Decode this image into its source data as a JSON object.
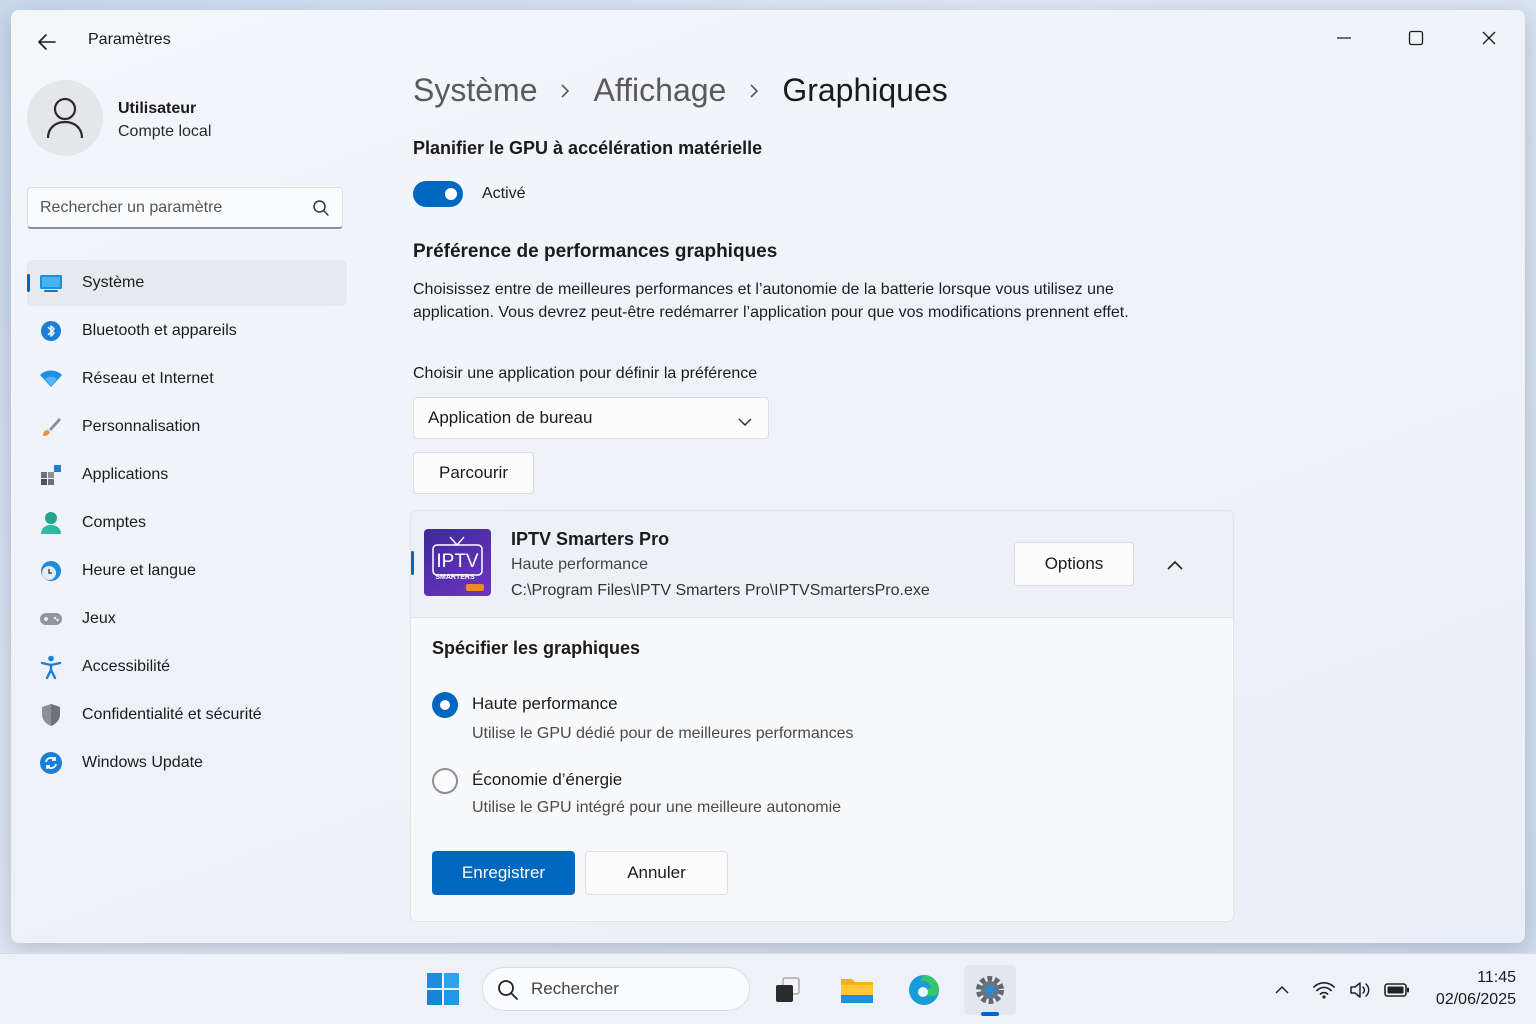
{
  "window": {
    "title": "Paramètres"
  },
  "user": {
    "name": "Utilisateur",
    "account": "Compte local"
  },
  "search": {
    "placeholder": "Rechercher un paramètre"
  },
  "sidebar": {
    "items": [
      {
        "label": "Système",
        "icon": "display-icon",
        "active": true
      },
      {
        "label": "Bluetooth et appareils",
        "icon": "bluetooth-icon"
      },
      {
        "label": "Réseau et Internet",
        "icon": "wifi-icon"
      },
      {
        "label": "Personnalisation",
        "icon": "paintbrush-icon"
      },
      {
        "label": "Applications",
        "icon": "apps-icon"
      },
      {
        "label": "Comptes",
        "icon": "person-icon"
      },
      {
        "label": "Heure et langue",
        "icon": "globe-clock-icon"
      },
      {
        "label": "Jeux",
        "icon": "gamepad-icon"
      },
      {
        "label": "Accessibilité",
        "icon": "accessibility-icon"
      },
      {
        "label": "Confidentialité et sécurité",
        "icon": "shield-icon"
      },
      {
        "label": "Windows Update",
        "icon": "update-icon"
      }
    ]
  },
  "breadcrumb": {
    "items": [
      "Système",
      "Affichage"
    ],
    "current": "Graphiques"
  },
  "gpu_scheduling": {
    "heading": "Planifier le GPU à accélération matérielle",
    "toggle_state": "on",
    "toggle_label": "Activé"
  },
  "performance": {
    "heading": "Préférence de performances graphiques",
    "description": "Choisissez entre de meilleures performances et l’autonomie de la batterie lorsque vous utilisez une application. Vous devrez peut-être redémarrer l’application pour que vos modifications prennent effet.",
    "choose_label": "Choisir une application pour définir la préférence",
    "app_type_selected": "Application de bureau",
    "browse_label": "Parcourir"
  },
  "app_entry": {
    "name": "IPTV Smarters Pro",
    "preference": "Haute performance",
    "path": "C:\\Program Files\\IPTV Smarters Pro\\IPTVSmartersPro.exe",
    "icon_text": "IPTV",
    "icon_subtext": "SMARTERS",
    "options_label": "Options",
    "spec_heading": "Spécifier les graphiques",
    "option_high_title": "Haute performance",
    "option_high_desc": "Utilise le GPU dédié pour de meilleures performances",
    "option_saver_title": "Économie d’énergie",
    "option_saver_desc": "Utilise le GPU intégré pour une meilleure autonomie",
    "selected_option": "Haute performance",
    "save_label": "Enregistrer",
    "cancel_label": "Annuler"
  },
  "taskbar": {
    "search_label": "Rechercher",
    "apps": [
      "task-view-icon",
      "file-explorer-icon",
      "edge-icon",
      "settings-icon"
    ],
    "active_app": "settings-icon",
    "time": "11:45",
    "date": "02/06/2025"
  },
  "colors": {
    "accent": "#0067c0",
    "window_bg": "#f0f3f9",
    "taskbar_bg": "#eef2f8"
  }
}
